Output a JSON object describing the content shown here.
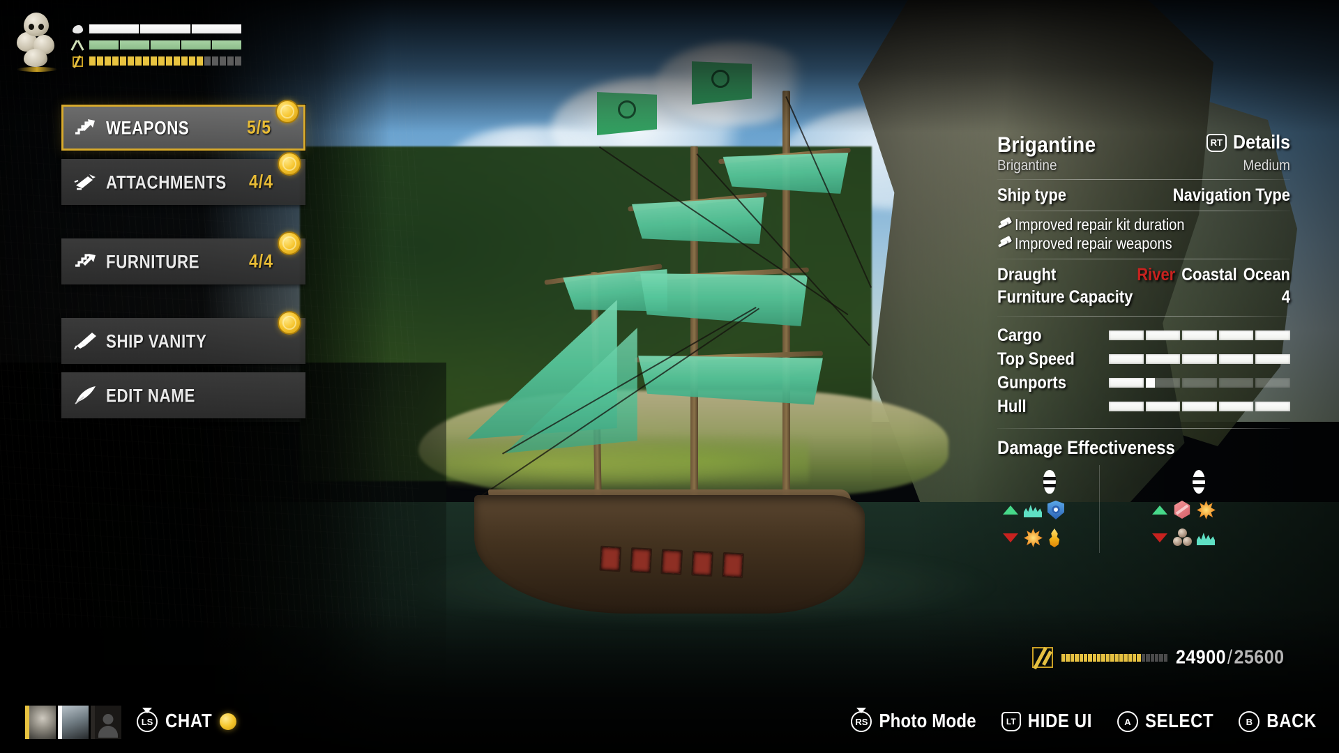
{
  "hud": {
    "avatar_icon": "skull-stack-icon",
    "bars": [
      {
        "name": "morale",
        "icon": "morale-icon",
        "fill_pct": 100,
        "segments": 3,
        "color": "#ffffff",
        "kind": "solid"
      },
      {
        "name": "food",
        "icon": "food-icon",
        "fill_pct": 100,
        "segments": 5,
        "color": "#9bcf9b",
        "kind": "solid"
      },
      {
        "name": "infamy",
        "icon": "infamy-icon",
        "fill_pct": 78,
        "segments": 20,
        "color": "#e8c340",
        "kind": "pips"
      }
    ]
  },
  "menu": {
    "items": [
      {
        "id": "weapons",
        "label": "WEAPONS",
        "icon": "weapon-upgrade-icon",
        "count": "5/5",
        "has_coin": true,
        "selected": true,
        "gap_above": false
      },
      {
        "id": "attachments",
        "label": "ATTACHMENTS",
        "icon": "attachment-icon",
        "count": "4/4",
        "has_coin": true,
        "selected": false,
        "gap_above": false
      },
      {
        "id": "furniture",
        "label": "FURNITURE",
        "icon": "furniture-upgrade-icon",
        "count": "4/4",
        "has_coin": true,
        "selected": false,
        "gap_above": true
      },
      {
        "id": "ship-vanity",
        "label": "SHIP VANITY",
        "icon": "paintbrush-icon",
        "count": "",
        "has_coin": true,
        "selected": false,
        "gap_above": true
      },
      {
        "id": "edit-name",
        "label": "EDIT NAME",
        "icon": "quill-icon",
        "count": "",
        "has_coin": false,
        "selected": false,
        "gap_above": false
      }
    ]
  },
  "ship_info": {
    "name": "Brigantine",
    "details_button": {
      "glyph": "RT",
      "label": "Details"
    },
    "subtitle_left": "Brigantine",
    "subtitle_right": "Medium",
    "row_ship_type": {
      "key": "Ship type",
      "value": "Navigation Type"
    },
    "perks": [
      {
        "icon": "hammer-icon",
        "text": "Improved repair kit duration"
      },
      {
        "icon": "hammer-icon",
        "text": "Improved repair weapons"
      }
    ],
    "draught": {
      "key": "Draught",
      "options": [
        {
          "label": "River",
          "active": false
        },
        {
          "label": "Coastal",
          "active": true
        },
        {
          "label": "Ocean",
          "active": true
        }
      ]
    },
    "furniture_capacity": {
      "key": "Furniture Capacity",
      "value": "4"
    },
    "stats": [
      {
        "name": "Cargo",
        "segments": 5,
        "filled": 5,
        "partial_pct": 100
      },
      {
        "name": "Top Speed",
        "segments": 5,
        "filled": 5,
        "partial_pct": 100
      },
      {
        "name": "Gunports",
        "segments": 5,
        "filled": 1,
        "partial_pct": 28
      },
      {
        "name": "Hull",
        "segments": 5,
        "filled": 5,
        "partial_pct": 100
      }
    ],
    "damage_section_title": "Damage Effectiveness",
    "damage_columns": [
      {
        "id": "ballistic",
        "ammo_icon": "ballistic-shell-icon",
        "rows": [
          {
            "trend": "up",
            "icons": [
              "flooding-icon",
              "shield-ward-icon"
            ]
          },
          {
            "trend": "down",
            "icons": [
              "explosive-icon",
              "fire-icon"
            ]
          }
        ]
      },
      {
        "id": "explosive",
        "ammo_icon": "explosive-shell-icon",
        "rows": [
          {
            "trend": "up",
            "icons": [
              "piercing-icon",
              "explosive-icon"
            ]
          },
          {
            "trend": "down",
            "icons": [
              "roundshot-icon",
              "flooding-icon"
            ]
          }
        ]
      }
    ]
  },
  "xp": {
    "icon": "infamy-badge-icon",
    "current": "24900",
    "separator": "/",
    "max": "25600",
    "fill_pct": 74
  },
  "bottom_bar": {
    "crew": [
      {
        "id": "captain",
        "accent": "#e8c340",
        "has_crown": true,
        "type": "portrait"
      },
      {
        "id": "mate",
        "accent": "#ffffff",
        "has_crown": false,
        "type": "portrait"
      },
      {
        "id": "empty",
        "accent": "#2a2724",
        "has_crown": false,
        "type": "empty"
      }
    ],
    "chat": {
      "glyph": "LS",
      "label": "CHAT",
      "has_notification": true
    },
    "prompts": [
      {
        "id": "photo-mode",
        "glyph": "RS",
        "glyph_style": "stick",
        "label": "Photo Mode",
        "case": "mixed"
      },
      {
        "id": "hide-ui",
        "glyph": "LT",
        "glyph_style": "trigger",
        "label": "HIDE UI",
        "case": "upper"
      },
      {
        "id": "select",
        "glyph": "A",
        "glyph_style": "round",
        "label": "SELECT",
        "case": "upper"
      },
      {
        "id": "back",
        "glyph": "B",
        "glyph_style": "round",
        "label": "BACK",
        "case": "upper"
      }
    ]
  },
  "colors": {
    "gold": "#d8aa2c",
    "coin": "#f6c42c",
    "danger_red": "#c8221f",
    "panel": "#3e3e3e",
    "panel_selected": "#707070"
  }
}
